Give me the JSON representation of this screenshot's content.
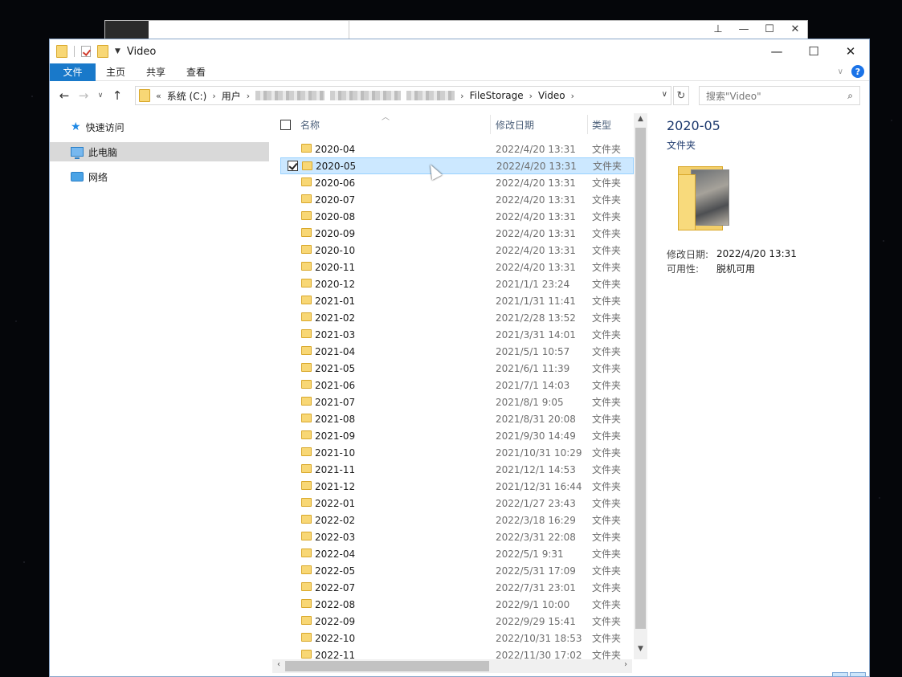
{
  "window": {
    "title": "Video"
  },
  "ribbon": {
    "tabs": [
      "文件",
      "主页",
      "共享",
      "查看"
    ],
    "help": "?"
  },
  "address": {
    "overflow": "«",
    "parts": [
      "系统 (C:)",
      "用户",
      "FileStorage",
      "Video"
    ],
    "search_placeholder": "搜索\"Video\""
  },
  "sidebar": {
    "items": [
      {
        "label": "快速访问",
        "icon": "star-icon"
      },
      {
        "label": "此电脑",
        "icon": "pc-icon"
      },
      {
        "label": "网络",
        "icon": "network-icon"
      }
    ]
  },
  "columns": {
    "name": "名称",
    "date": "修改日期",
    "type": "类型"
  },
  "selected_index": 1,
  "files": [
    {
      "name": "2020-04",
      "date": "2022/4/20 13:31",
      "type": "文件夹"
    },
    {
      "name": "2020-05",
      "date": "2022/4/20 13:31",
      "type": "文件夹"
    },
    {
      "name": "2020-06",
      "date": "2022/4/20 13:31",
      "type": "文件夹"
    },
    {
      "name": "2020-07",
      "date": "2022/4/20 13:31",
      "type": "文件夹"
    },
    {
      "name": "2020-08",
      "date": "2022/4/20 13:31",
      "type": "文件夹"
    },
    {
      "name": "2020-09",
      "date": "2022/4/20 13:31",
      "type": "文件夹"
    },
    {
      "name": "2020-10",
      "date": "2022/4/20 13:31",
      "type": "文件夹"
    },
    {
      "name": "2020-11",
      "date": "2022/4/20 13:31",
      "type": "文件夹"
    },
    {
      "name": "2020-12",
      "date": "2021/1/1 23:24",
      "type": "文件夹"
    },
    {
      "name": "2021-01",
      "date": "2021/1/31 11:41",
      "type": "文件夹"
    },
    {
      "name": "2021-02",
      "date": "2021/2/28 13:52",
      "type": "文件夹"
    },
    {
      "name": "2021-03",
      "date": "2021/3/31 14:01",
      "type": "文件夹"
    },
    {
      "name": "2021-04",
      "date": "2021/5/1 10:57",
      "type": "文件夹"
    },
    {
      "name": "2021-05",
      "date": "2021/6/1 11:39",
      "type": "文件夹"
    },
    {
      "name": "2021-06",
      "date": "2021/7/1 14:03",
      "type": "文件夹"
    },
    {
      "name": "2021-07",
      "date": "2021/8/1 9:05",
      "type": "文件夹"
    },
    {
      "name": "2021-08",
      "date": "2021/8/31 20:08",
      "type": "文件夹"
    },
    {
      "name": "2021-09",
      "date": "2021/9/30 14:49",
      "type": "文件夹"
    },
    {
      "name": "2021-10",
      "date": "2021/10/31 10:29",
      "type": "文件夹"
    },
    {
      "name": "2021-11",
      "date": "2021/12/1 14:53",
      "type": "文件夹"
    },
    {
      "name": "2021-12",
      "date": "2021/12/31 16:44",
      "type": "文件夹"
    },
    {
      "name": "2022-01",
      "date": "2022/1/27 23:43",
      "type": "文件夹"
    },
    {
      "name": "2022-02",
      "date": "2022/3/18 16:29",
      "type": "文件夹"
    },
    {
      "name": "2022-03",
      "date": "2022/3/31 22:08",
      "type": "文件夹"
    },
    {
      "name": "2022-04",
      "date": "2022/5/1 9:31",
      "type": "文件夹"
    },
    {
      "name": "2022-05",
      "date": "2022/5/31 17:09",
      "type": "文件夹"
    },
    {
      "name": "2022-07",
      "date": "2022/7/31 23:01",
      "type": "文件夹"
    },
    {
      "name": "2022-08",
      "date": "2022/9/1 10:00",
      "type": "文件夹"
    },
    {
      "name": "2022-09",
      "date": "2022/9/29 15:41",
      "type": "文件夹"
    },
    {
      "name": "2022-10",
      "date": "2022/10/31 18:53",
      "type": "文件夹"
    },
    {
      "name": "2022-11",
      "date": "2022/11/30 17:02",
      "type": "文件夹"
    }
  ],
  "details": {
    "title": "2020-05",
    "type": "文件夹",
    "modified_label": "修改日期:",
    "modified_value": "2022/4/20 13:31",
    "availability_label": "可用性:",
    "availability_value": "脱机可用"
  },
  "colors": {
    "accent": "#1979ca",
    "selection": "#cce8ff",
    "folder": "#f8d775"
  }
}
